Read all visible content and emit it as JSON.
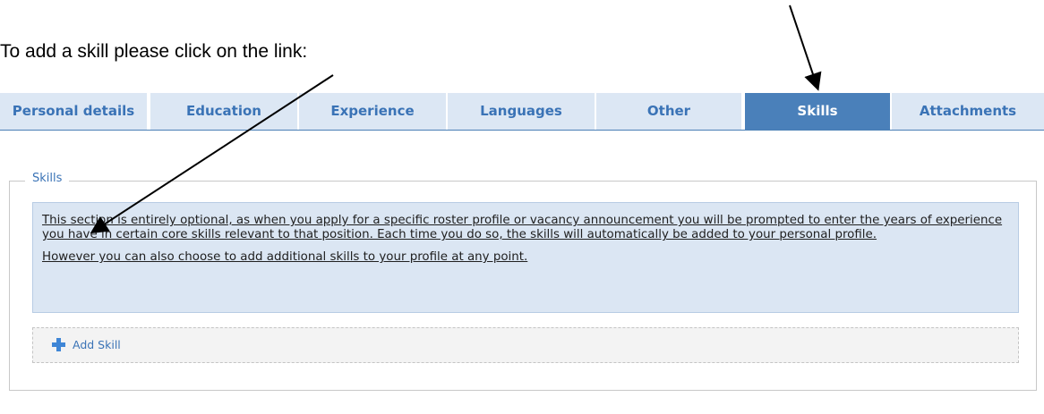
{
  "instruction": "To add a skill please click on the link:",
  "tabs": [
    {
      "label": "Personal details",
      "active": false
    },
    {
      "label": "Education",
      "active": false
    },
    {
      "label": "Experience",
      "active": false
    },
    {
      "label": "Languages",
      "active": false
    },
    {
      "label": "Other",
      "active": false
    },
    {
      "label": "Skills",
      "active": true
    },
    {
      "label": "Attachments",
      "active": false
    }
  ],
  "skills_section": {
    "legend": "Skills",
    "paragraph1": "This section is entirely optional, as when you apply for a specific roster profile or vacancy announcement you will be prompted to enter the years of experience you have in certain core skills relevant to that position. Each time you do so, the skills will automatically be added to your personal profile.",
    "paragraph2": "However you can also choose to add additional skills to your profile at any point.",
    "add_label": "Add Skill",
    "add_icon": "plus-icon"
  },
  "colors": {
    "tab_bg": "#dce7f4",
    "tab_active_bg": "#4a80ba",
    "tab_text": "#3a73b6",
    "info_bg": "#dbe6f3",
    "add_icon": "#3f86d6"
  }
}
